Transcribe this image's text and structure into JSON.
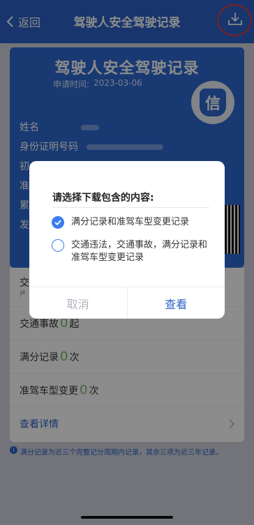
{
  "nav": {
    "back_label": "返回",
    "title": "驾驶人安全驾驶记录"
  },
  "card": {
    "title": "驾驶人安全驾驶记录",
    "apply_label": "申请时间:",
    "apply_date": "2023-03-06",
    "seal_char": "信",
    "fields": {
      "name": "姓名",
      "id_number": "身份证明号码",
      "row3": "初",
      "row4": "准",
      "row5": "累",
      "row6": "发"
    }
  },
  "list": {
    "row1_label": "交",
    "row1_sub": "严",
    "accident_label": "交通事故",
    "accident_count": "0",
    "accident_unit": "起",
    "fullscore_label": "满分记录",
    "fullscore_count": "0",
    "fullscore_unit": "次",
    "vehicle_change_label": "准驾车型变更",
    "vehicle_change_count": "0",
    "vehicle_change_unit": "次",
    "details_link": "查看详情"
  },
  "note": "满分记录为近三个完整记分周期内记录，其余三项为近三年记录。",
  "dialog": {
    "title": "请选择下载包含的内容:",
    "options": [
      {
        "label": "满分记录和准驾车型变更记录",
        "checked": true
      },
      {
        "label": "交通违法，交通事故，满分记录和准驾车型变更记录",
        "checked": false
      }
    ],
    "cancel_label": "取消",
    "confirm_label": "查看"
  },
  "colors": {
    "primary": "#2d62c6",
    "accent_check": "#3b7df0",
    "highlight_ring": "#e83a3a",
    "count_green": "#7bb86a"
  }
}
